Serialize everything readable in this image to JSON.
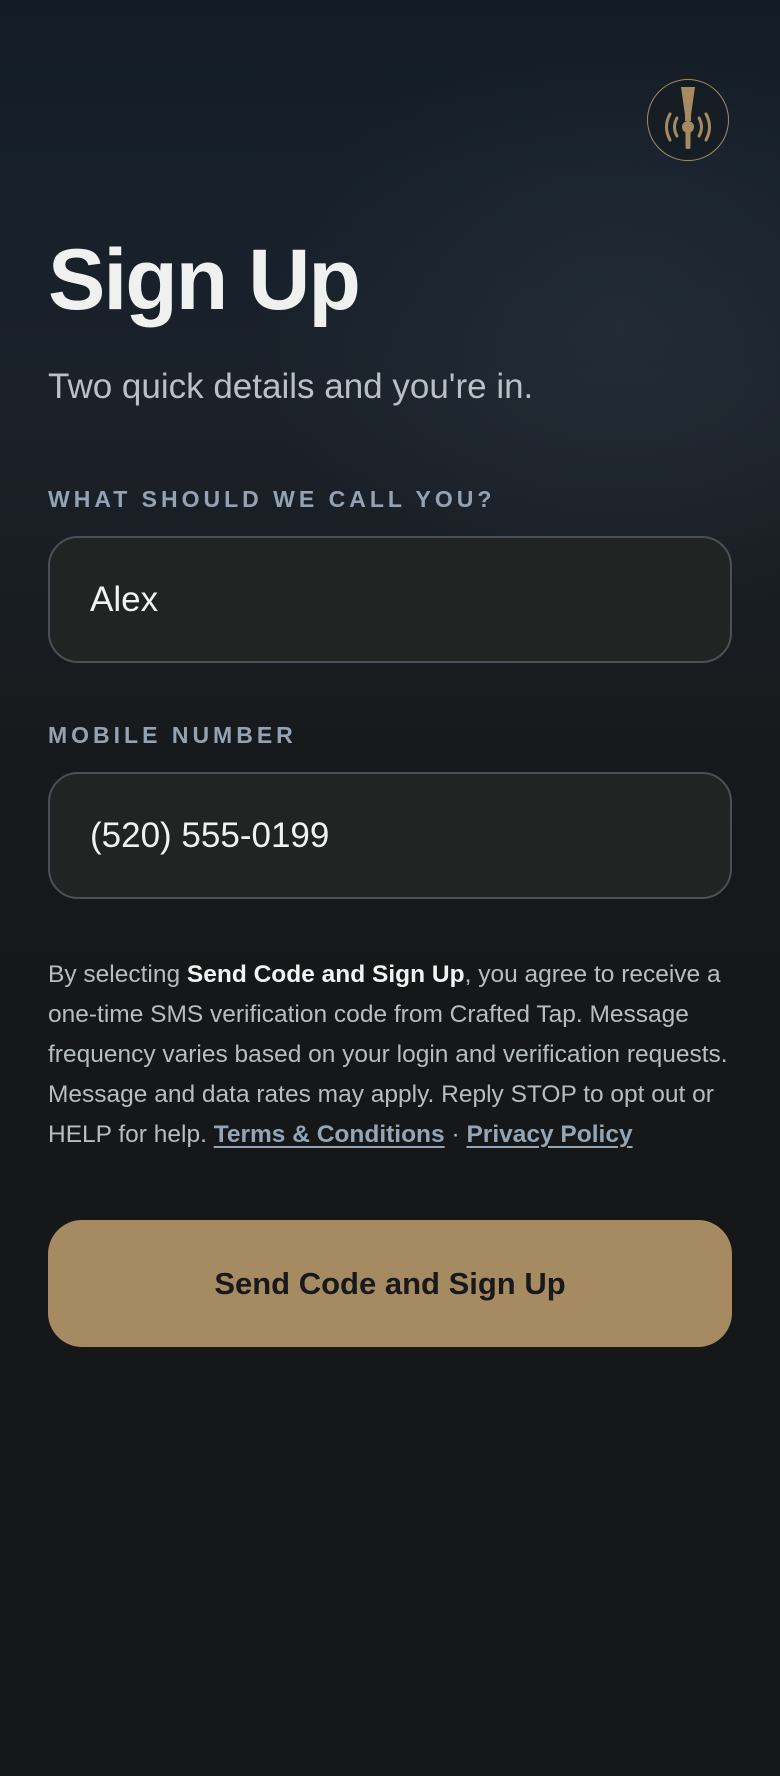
{
  "brand": {
    "logo_icon": "beer-tap-icon",
    "accent_color": "#a68a62"
  },
  "header": {
    "title": "Sign Up",
    "subtitle": "Two quick details and you're in."
  },
  "form": {
    "name": {
      "label": "WHAT SHOULD WE CALL YOU?",
      "value": "Alex"
    },
    "phone": {
      "label": "MOBILE NUMBER",
      "value": "(520) 555-0199"
    }
  },
  "consent": {
    "prefix": "By selecting ",
    "bold": "Send Code and Sign Up",
    "body": ", you agree to receive a one-time SMS verification code from Crafted Tap. Message frequency varies based on your login and verification requests. Message and data rates may apply. Reply STOP to opt out or HELP for help. ",
    "terms_link": "Terms & Conditions",
    "separator": " · ",
    "privacy_link": "Privacy Policy"
  },
  "cta": {
    "label": "Send Code and Sign Up"
  }
}
